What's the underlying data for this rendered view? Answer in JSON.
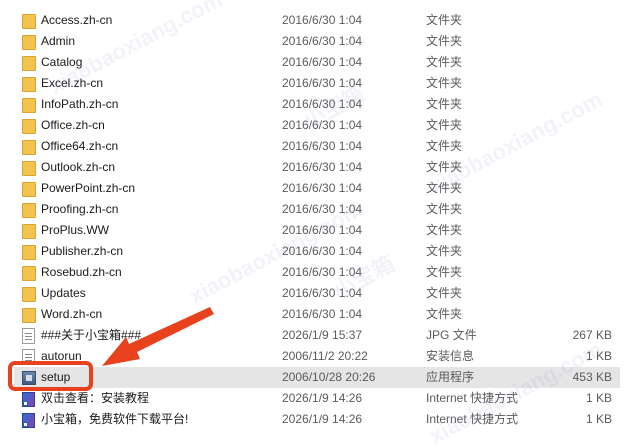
{
  "files": [
    {
      "name": "Access.zh-cn",
      "date": "2016/6/30 1:04",
      "type": "文件夹",
      "size": "",
      "icon": "folder-icon"
    },
    {
      "name": "Admin",
      "date": "2016/6/30 1:04",
      "type": "文件夹",
      "size": "",
      "icon": "folder-icon"
    },
    {
      "name": "Catalog",
      "date": "2016/6/30 1:04",
      "type": "文件夹",
      "size": "",
      "icon": "folder-icon"
    },
    {
      "name": "Excel.zh-cn",
      "date": "2016/6/30 1:04",
      "type": "文件夹",
      "size": "",
      "icon": "folder-icon"
    },
    {
      "name": "InfoPath.zh-cn",
      "date": "2016/6/30 1:04",
      "type": "文件夹",
      "size": "",
      "icon": "folder-icon"
    },
    {
      "name": "Office.zh-cn",
      "date": "2016/6/30 1:04",
      "type": "文件夹",
      "size": "",
      "icon": "folder-icon"
    },
    {
      "name": "Office64.zh-cn",
      "date": "2016/6/30 1:04",
      "type": "文件夹",
      "size": "",
      "icon": "folder-icon"
    },
    {
      "name": "Outlook.zh-cn",
      "date": "2016/6/30 1:04",
      "type": "文件夹",
      "size": "",
      "icon": "folder-icon"
    },
    {
      "name": "PowerPoint.zh-cn",
      "date": "2016/6/30 1:04",
      "type": "文件夹",
      "size": "",
      "icon": "folder-icon"
    },
    {
      "name": "Proofing.zh-cn",
      "date": "2016/6/30 1:04",
      "type": "文件夹",
      "size": "",
      "icon": "folder-icon"
    },
    {
      "name": "ProPlus.WW",
      "date": "2016/6/30 1:04",
      "type": "文件夹",
      "size": "",
      "icon": "folder-icon"
    },
    {
      "name": "Publisher.zh-cn",
      "date": "2016/6/30 1:04",
      "type": "文件夹",
      "size": "",
      "icon": "folder-icon"
    },
    {
      "name": "Rosebud.zh-cn",
      "date": "2016/6/30 1:04",
      "type": "文件夹",
      "size": "",
      "icon": "folder-icon"
    },
    {
      "name": "Updates",
      "date": "2016/6/30 1:04",
      "type": "文件夹",
      "size": "",
      "icon": "folder-icon"
    },
    {
      "name": "Word.zh-cn",
      "date": "2016/6/30 1:04",
      "type": "文件夹",
      "size": "",
      "icon": "folder-icon"
    },
    {
      "name": "###关于小宝箱###",
      "date": "2026/1/9 15:37",
      "type": "JPG 文件",
      "size": "267 KB",
      "icon": "image-file-icon"
    },
    {
      "name": "autorun",
      "date": "2006/11/2 20:22",
      "type": "安装信息",
      "size": "1 KB",
      "icon": "file-icon"
    },
    {
      "name": "setup",
      "date": "2006/10/28 20:26",
      "type": "应用程序",
      "size": "453 KB",
      "icon": "app-icon",
      "selected": true
    },
    {
      "name": "双击查看：安装教程",
      "date": "2026/1/9 14:26",
      "type": "Internet 快捷方式",
      "size": "1 KB",
      "icon": "shortcut-icon"
    },
    {
      "name": "小宝箱，免费软件下载平台!",
      "date": "2026/1/9 14:26",
      "type": "Internet 快捷方式",
      "size": "1 KB",
      "icon": "shortcut-icon"
    }
  ],
  "watermark": "xiaobaoxiang.com",
  "watermark_cn": "小宝箱",
  "colors": {
    "highlight": "#e8411e",
    "selected_row": "#e5e5e5",
    "folder": "#f3c34f"
  }
}
